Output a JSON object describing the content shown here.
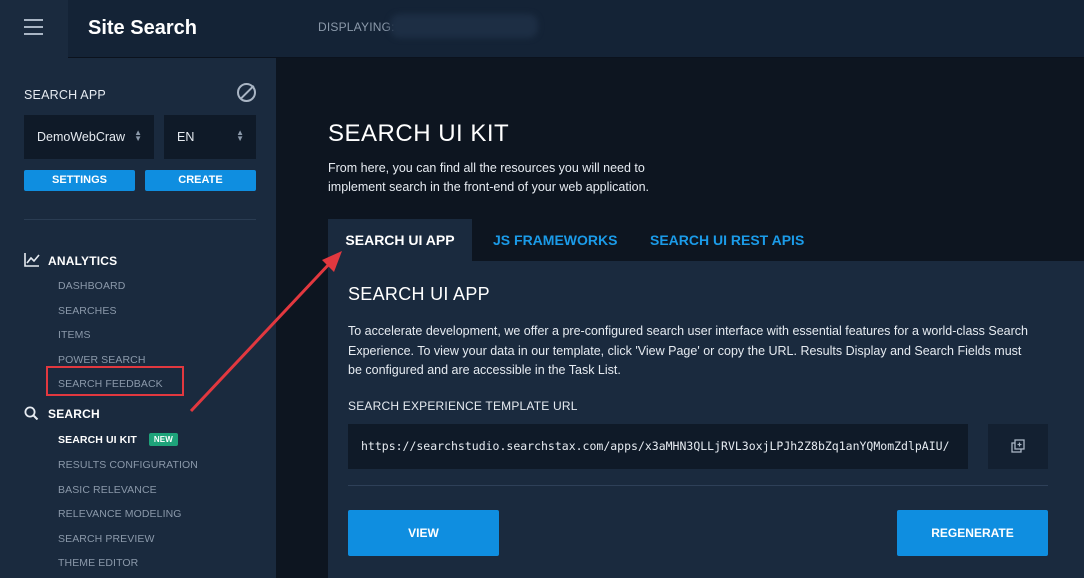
{
  "header": {
    "app_title": "Site Search",
    "displaying_label": "DISPLAYING:"
  },
  "sidebar": {
    "search_app_label": "SEARCH APP",
    "app_select_value": "DemoWebCraw",
    "lang_select_value": "EN",
    "settings_label": "SETTINGS",
    "create_label": "CREATE",
    "analytics": {
      "title": "ANALYTICS",
      "items": [
        "DASHBOARD",
        "SEARCHES",
        "ITEMS",
        "POWER SEARCH",
        "SEARCH FEEDBACK"
      ]
    },
    "search": {
      "title": "SEARCH",
      "active_item": "SEARCH UI KIT",
      "badge": "NEW",
      "items": [
        "RESULTS CONFIGURATION",
        "BASIC RELEVANCE",
        "RELEVANCE MODELING",
        "SEARCH PREVIEW",
        "THEME EDITOR"
      ]
    }
  },
  "main": {
    "title": "SEARCH UI KIT",
    "description": "From here, you can find all the resources you will need to implement search in the front-end of your web application.",
    "tabs": [
      {
        "label": "SEARCH UI APP",
        "active": true
      },
      {
        "label": "JS FRAMEWORKS",
        "active": false
      },
      {
        "label": "SEARCH UI REST APIS",
        "active": false
      }
    ],
    "panel": {
      "title": "SEARCH UI APP",
      "description": "To accelerate development, we offer a pre-configured search user interface with essential features for a world-class Search Experience. To view your data in our template, click 'View Page' or copy the URL. Results Display and Search Fields must be configured and are accessible in the Task List.",
      "url_label": "SEARCH EXPERIENCE TEMPLATE URL",
      "url_value": "https://searchstudio.searchstax.com/apps/x3aMHN3QLLjRVL3oxjLPJh2Z8bZq1anYQMomZdlpAIU/",
      "view_label": "VIEW",
      "regenerate_label": "REGENERATE"
    }
  },
  "colors": {
    "accent": "#0f8ee0",
    "tab_link": "#1b9be8",
    "badge": "#1ea37a",
    "annotation": "#e2383f"
  }
}
